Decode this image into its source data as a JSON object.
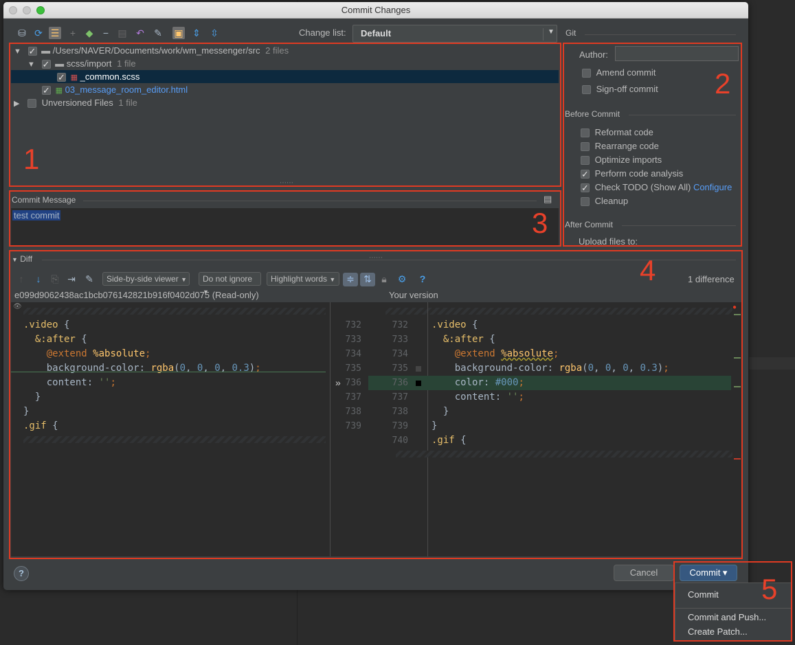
{
  "window": {
    "title": "Commit Changes"
  },
  "toolbar": {
    "changelist_label": "Change list:",
    "changelist_value": "Default",
    "git_label": "Git"
  },
  "tree": [
    {
      "label": "/Users/NAVER/Documents/work/wm_messenger/src",
      "meta": "2 files"
    },
    {
      "label": "scss/import",
      "meta": "1 file"
    },
    {
      "label": "_common.scss",
      "meta": ""
    },
    {
      "label": "03_message_room_editor.html",
      "meta": ""
    },
    {
      "label": "Unversioned Files",
      "meta": "1 file"
    }
  ],
  "git": {
    "author_label": "Author:",
    "author_value": "",
    "amend": "Amend commit",
    "signoff": "Sign-off commit",
    "before_title": "Before Commit",
    "reformat": "Reformat code",
    "rearrange": "Rearrange code",
    "optimize": "Optimize imports",
    "analysis": "Perform code analysis",
    "todo": "Check TODO (Show All)",
    "configure": "Configure",
    "cleanup": "Cleanup",
    "after_title": "After Commit",
    "upload": "Upload files to:"
  },
  "commit_message": {
    "title": "Commit Message",
    "text": "test commit"
  },
  "diff": {
    "title": "Diff",
    "viewer": "Side-by-side viewer",
    "ignore": "Do not ignore",
    "highlight": "Highlight words",
    "help": "?",
    "differences": "1 difference",
    "left_title": "e099d9062438ac1bcb076142821b916f0402d075 (Read-only)",
    "right_title": "Your version",
    "left_nums": [
      "732",
      "733",
      "734",
      "735",
      "736",
      "737",
      "738",
      "739"
    ],
    "right_nums": [
      "732",
      "733",
      "734",
      "735",
      "736",
      "737",
      "738",
      "739",
      "740"
    ]
  },
  "annotations": [
    "1",
    "2",
    "3",
    "4",
    "5"
  ],
  "buttons": {
    "help": "?",
    "cancel": "Cancel",
    "commit": "Commit ▾"
  },
  "menu": {
    "commit": "Commit",
    "commit_push": "Commit and Push...",
    "patch": "Create Patch..."
  }
}
